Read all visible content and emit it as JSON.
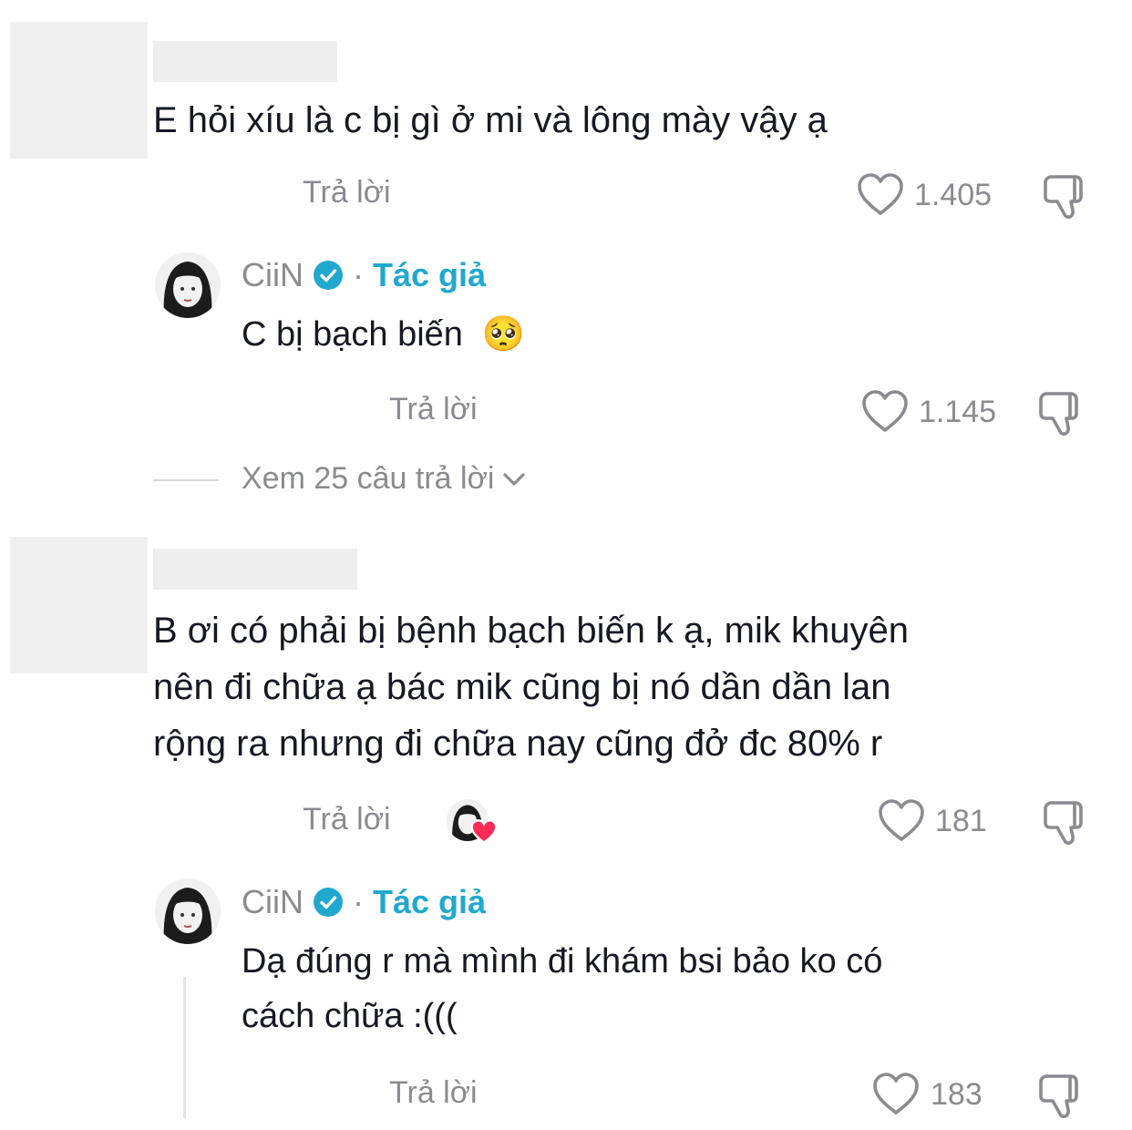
{
  "thread1": {
    "comment_text": "E hỏi xíu là c bị gì ở mi và lông mày vậy ạ",
    "reply_label": "Trả lời",
    "likes": "1.405",
    "author_reply": {
      "username": "CiiN",
      "separator": "·",
      "author_tag": "Tác giả",
      "text": "C bị bạch biến",
      "emoji": "🥺",
      "reply_label": "Trả lời",
      "likes": "1.145"
    },
    "view_more": "Xem 25 câu trả lời"
  },
  "thread2": {
    "comment_text_lines": [
      "B ơi có phải bị bệnh bạch biến k ạ, mik khuyên",
      "nên đi chữa ạ bác mik cũng bị nó dần dần lan",
      "rộng ra nhưng đi chữa nay cũng đở đc 80% r"
    ],
    "reply_label": "Trả lời",
    "likes": "181",
    "author_reply": {
      "username": "CiiN",
      "separator": "·",
      "author_tag": "Tác giả",
      "text_lines": [
        "Dạ đúng r mà mình đi khám bsi bảo ko có",
        "cách chữa :((("
      ],
      "reply_label": "Trả lời",
      "likes": "183"
    }
  },
  "colors": {
    "accent": "#20a8cf",
    "muted": "#8a8b91",
    "text": "#161823",
    "like_heart": "#fe2c55"
  }
}
